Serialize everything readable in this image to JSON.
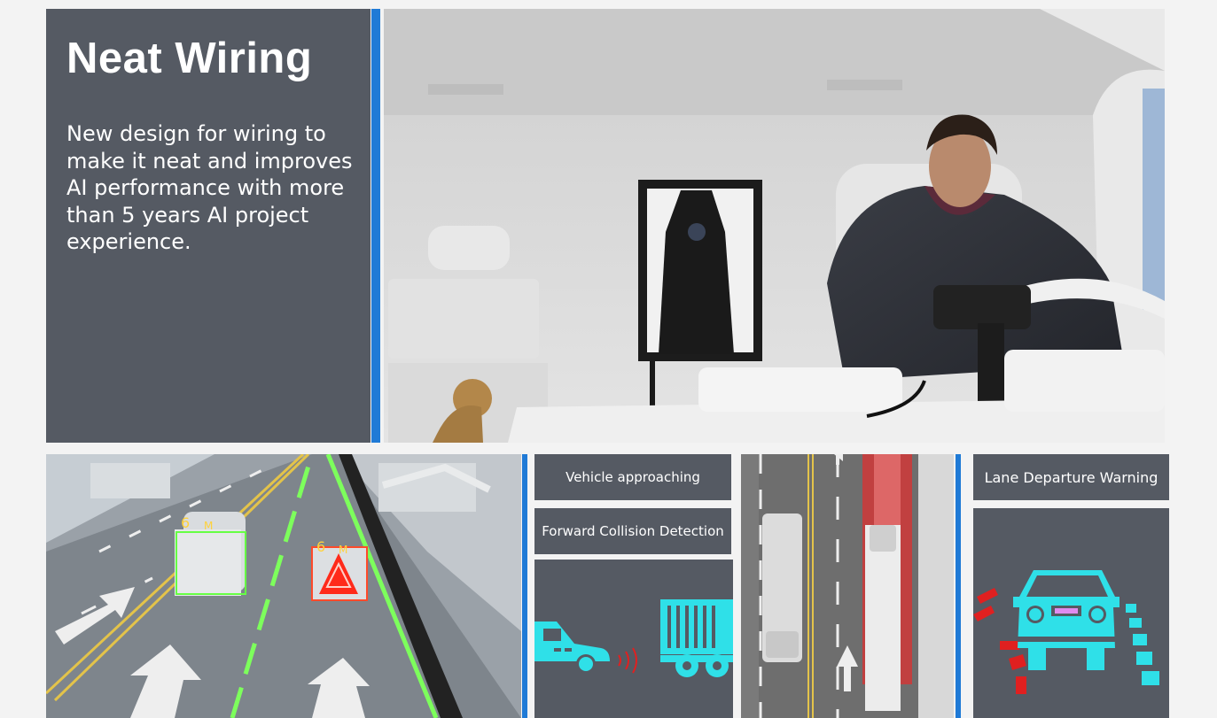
{
  "title": "Neat Wiring",
  "description": "New design for wiring to make it neat and improves AI performance with more than 5 years AI  project experience.",
  "labels": {
    "vehicle_approaching": "Vehicle approaching",
    "forward_collision": "Forward Collision Detection",
    "lane_departure": "Lane Departure Warning"
  },
  "distance_markers": {
    "left_value": "6",
    "left_unit": "M",
    "right_value": "6",
    "right_unit": "M"
  },
  "colors": {
    "panel_bg": "#555a63",
    "accent_blue": "#1f7ad6",
    "icon_cyan": "#2fe0e8",
    "warning_red": "#e02020",
    "detect_green": "#66ff44"
  },
  "icons": [
    "car-icon",
    "truck-icon",
    "signal-waves-icon",
    "car-front-icon",
    "lane-markers-icon",
    "warning-triangle-icon"
  ]
}
